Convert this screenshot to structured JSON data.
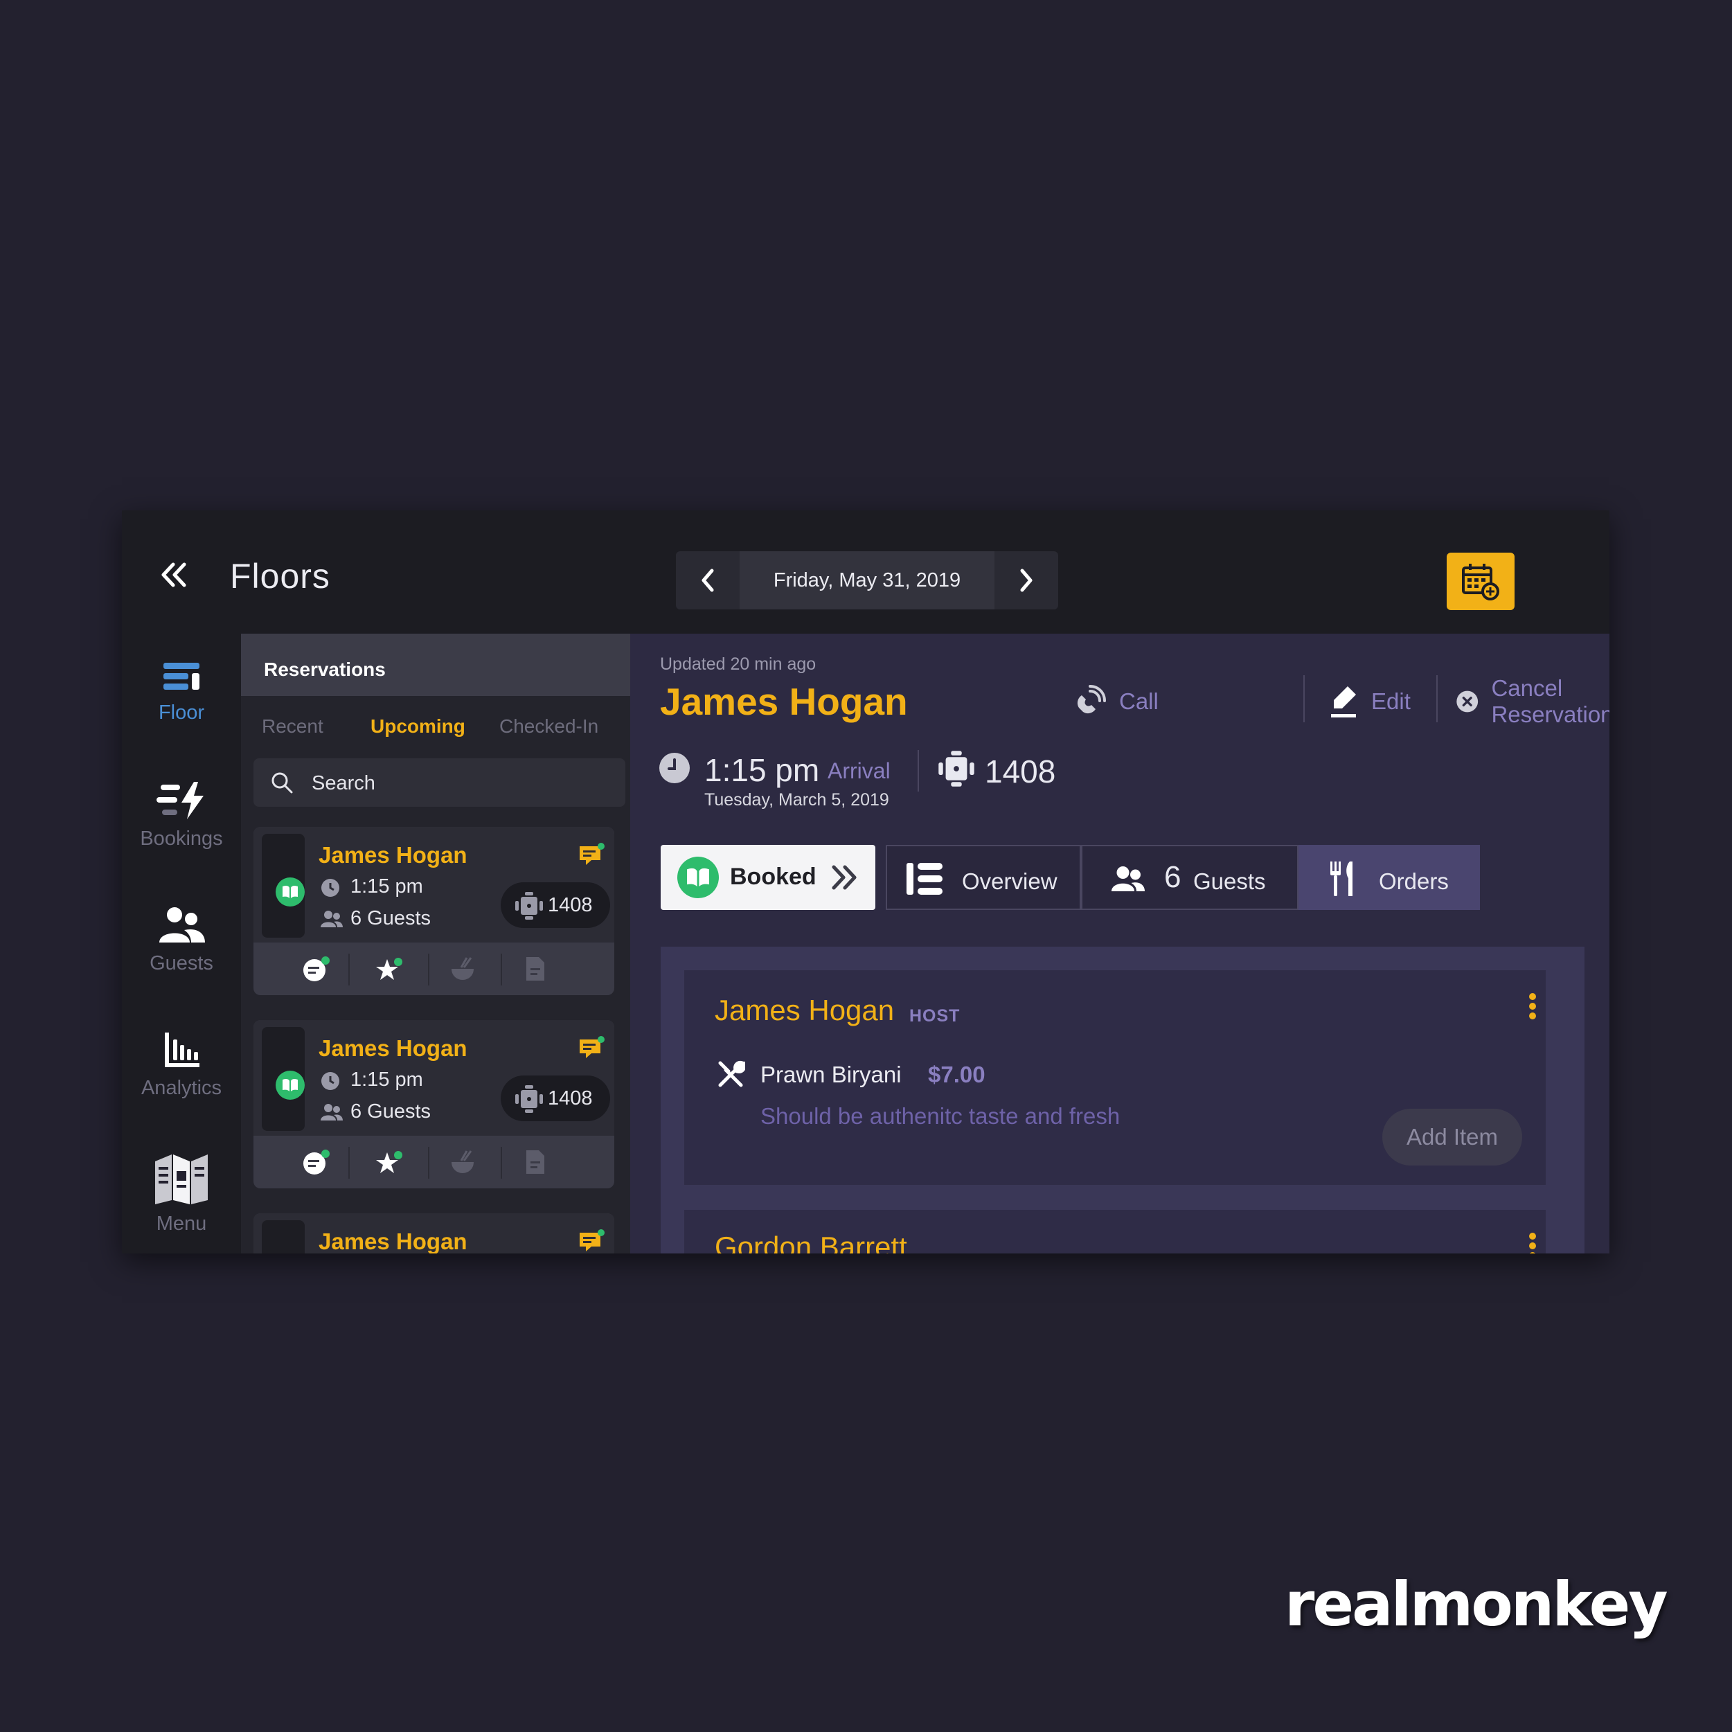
{
  "header": {
    "title": "Floors",
    "date": "Friday, May 31, 2019"
  },
  "rail": {
    "items": [
      {
        "label": "Floor",
        "icon": "floor-icon",
        "active": true
      },
      {
        "label": "Bookings",
        "icon": "bookings-icon"
      },
      {
        "label": "Guests",
        "icon": "guests-icon"
      },
      {
        "label": "Analytics",
        "icon": "analytics-icon"
      },
      {
        "label": "Menu",
        "icon": "menu-book-icon"
      }
    ]
  },
  "reservations": {
    "title": "Reservations",
    "tabs": [
      "Recent",
      "Upcoming",
      "Checked-In"
    ],
    "active_tab": "Upcoming",
    "search_placeholder": "Search",
    "cards": [
      {
        "name": "James Hogan",
        "time": "1:15 pm",
        "guests": "6 Guests",
        "table": "1408"
      },
      {
        "name": "James Hogan",
        "time": "1:15 pm",
        "guests": "6 Guests",
        "table": "1408"
      },
      {
        "name": "James Hogan"
      }
    ]
  },
  "detail": {
    "updated": "Updated 20 min ago",
    "guest_name": "James Hogan",
    "actions": {
      "call": "Call",
      "edit": "Edit",
      "cancel": "Cancel Reservation"
    },
    "arrival": {
      "time": "1:15 pm",
      "label": "Arrival",
      "date": "Tuesday, March 5, 2019",
      "table": "1408"
    },
    "status": "Booked",
    "tabs": {
      "overview": "Overview",
      "guests_count": "6",
      "guests": "Guests",
      "orders": "Orders"
    },
    "orders": [
      {
        "name": "James Hogan",
        "role": "HOST",
        "item": "Prawn Biryani",
        "price": "$7.00",
        "note": "Should be authenitc taste and fresh",
        "add_label": "Add Item"
      },
      {
        "name": "Gordon Barrett"
      }
    ]
  },
  "brand": "realmonkey",
  "colors": {
    "accent": "#f2b117",
    "booked": "#2ebc6c",
    "floor_active": "#4a8fd6",
    "purple_text": "#8a7fc0"
  }
}
